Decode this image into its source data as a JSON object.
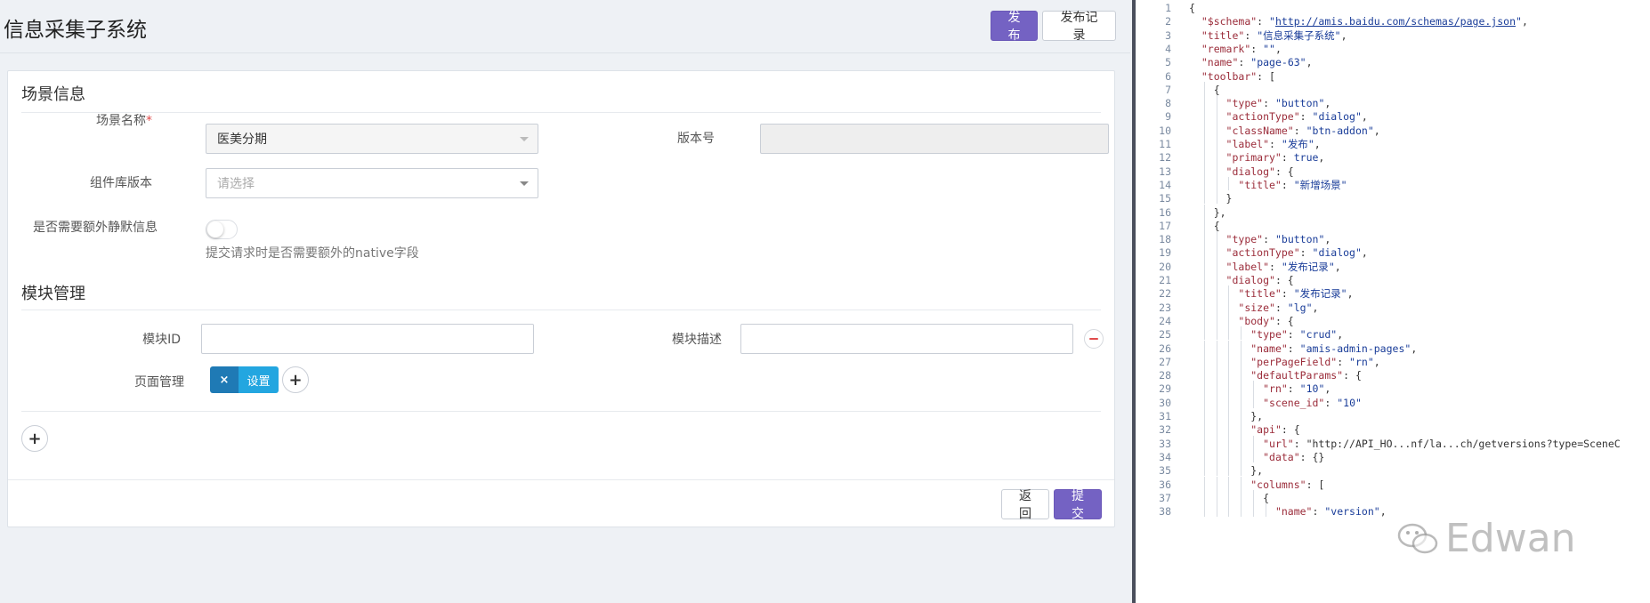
{
  "header": {
    "title": "信息采集子系统",
    "publish_label": "发布",
    "history_label": "发布记录"
  },
  "scene_section": {
    "title": "场景信息",
    "name_label": "场景名称",
    "name_required_mark": "*",
    "name_value": "医美分期",
    "version_label": "版本号",
    "version_value": "",
    "lib_version_label": "组件库版本",
    "lib_version_placeholder": "请选择",
    "silent_label": "是否需要额外静默信息",
    "silent_enabled": false,
    "silent_help": "提交请求时是否需要额外的native字段"
  },
  "module_section": {
    "title": "模块管理",
    "module_id_label": "模块ID",
    "module_id_value": "",
    "module_desc_label": "模块描述",
    "module_desc_value": "",
    "page_manage_label": "页面管理",
    "page_tag_remove": "×",
    "page_tag_label": "设置",
    "add_page_symbol": "+",
    "add_module_symbol": "+"
  },
  "footer": {
    "back_label": "返回",
    "submit_label": "提交"
  },
  "colors": {
    "primary": "#7462c3",
    "tag_dark": "#1f7ab5",
    "tag_light": "#23a6e0",
    "danger": "#e04b4b",
    "code_key": "#9b2c3a",
    "code_string": "#1a3d99"
  },
  "editor": {
    "line_numbers": [
      "1",
      "2",
      "3",
      "4",
      "5",
      "6",
      "7",
      "8",
      "9",
      "10",
      "11",
      "12",
      "13",
      "14",
      "15",
      "16",
      "17",
      "18",
      "19",
      "20",
      "21",
      "22",
      "23",
      "24",
      "25",
      "26",
      "27",
      "28",
      "29",
      "30",
      "31",
      "32",
      "33",
      "34",
      "35",
      "36",
      "37",
      "38"
    ],
    "lines": [
      "{",
      "  \"$schema\": \"http://amis.baidu.com/schemas/page.json\",",
      "  \"title\": \"信息采集子系统\",",
      "  \"remark\": \"\",",
      "  \"name\": \"page-63\",",
      "  \"toolbar\": [",
      "    {",
      "      \"type\": \"button\",",
      "      \"actionType\": \"dialog\",",
      "      \"className\": \"btn-addon\",",
      "      \"label\": \"发布\",",
      "      \"primary\": true,",
      "      \"dialog\": {",
      "        \"title\": \"新增场景\"",
      "      }",
      "    },",
      "    {",
      "      \"type\": \"button\",",
      "      \"actionType\": \"dialog\",",
      "      \"label\": \"发布记录\",",
      "      \"dialog\": {",
      "        \"title\": \"发布记录\",",
      "        \"size\": \"lg\",",
      "        \"body\": {",
      "          \"type\": \"crud\",",
      "          \"name\": \"amis-admin-pages\",",
      "          \"perPageField\": \"rn\",",
      "          \"defaultParams\": {",
      "            \"rn\": \"10\",",
      "            \"scene_id\": \"10\"",
      "          },",
      "          \"api\": {",
      "            \"url\": \"http://API_HO...nf/la...ch/getversions?type=SceneC",
      "            \"data\": {}",
      "          },",
      "          \"columns\": [",
      "            {",
      "              \"name\": \"version\","
    ]
  },
  "watermark": {
    "text": "Edwan",
    "icon": "wechat-icon"
  }
}
